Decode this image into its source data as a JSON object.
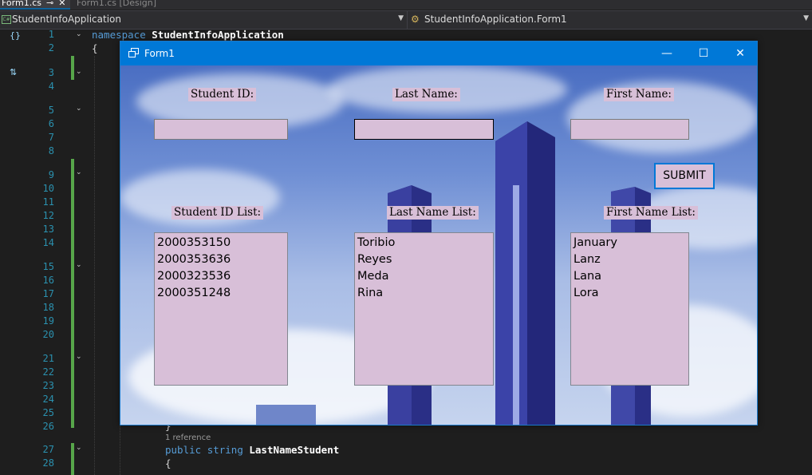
{
  "ide": {
    "tabs": [
      {
        "label": "Form1.cs",
        "pin": "⊸",
        "close": "✕"
      },
      {
        "label": "Form1.cs [Design]"
      }
    ],
    "nav": {
      "project_icon": "C#",
      "project": "StudentInfoApplication",
      "class_path": "StudentInfoApplication.Form1"
    },
    "line_numbers": [
      "1",
      "2",
      "3",
      "4",
      "5",
      "6",
      "7",
      "8",
      "9",
      "10",
      "11",
      "12",
      "13",
      "14",
      "15",
      "16",
      "17",
      "18",
      "19",
      "20",
      "21",
      "22",
      "23",
      "24",
      "25",
      "26",
      "27",
      "28"
    ],
    "code": {
      "line1_kw": "namespace",
      "line1_name": "StudentInfoApplication",
      "line2": "{",
      "line26": "}",
      "codelens": "1 reference",
      "line27_kw1": "public",
      "line27_kw2": "string",
      "line27_name": "LastNameStudent",
      "line28": "{"
    },
    "colors": {
      "background": "#1e1e1e",
      "line_number": "#2b91af",
      "keyword": "#569cd6",
      "change_bar": "#57a64a"
    }
  },
  "form": {
    "title": "Form1",
    "controls": {
      "minimize": "—",
      "maximize": "☐",
      "close": "✕"
    },
    "labels": {
      "student_id": "Student ID:",
      "last_name": "Last Name:",
      "first_name": "First Name:",
      "student_id_list": "Student ID List:",
      "last_name_list": "Last Name List:",
      "first_name_list": "First Name List:"
    },
    "inputs": {
      "student_id": "",
      "last_name": "",
      "first_name": ""
    },
    "submit_label": "SUBMIT",
    "lists": {
      "student_ids": [
        "2000353150",
        "2000353636",
        "2000323536",
        "2000351248"
      ],
      "last_names": [
        "Toribio",
        "Reyes",
        "Meda",
        "Rina"
      ],
      "first_names": [
        "January",
        "Lanz",
        "Lana",
        "Lora"
      ]
    },
    "colors": {
      "titlebar": "#0078d7",
      "control_bg": "#d8bfd8",
      "button_border": "#0078d7"
    }
  }
}
